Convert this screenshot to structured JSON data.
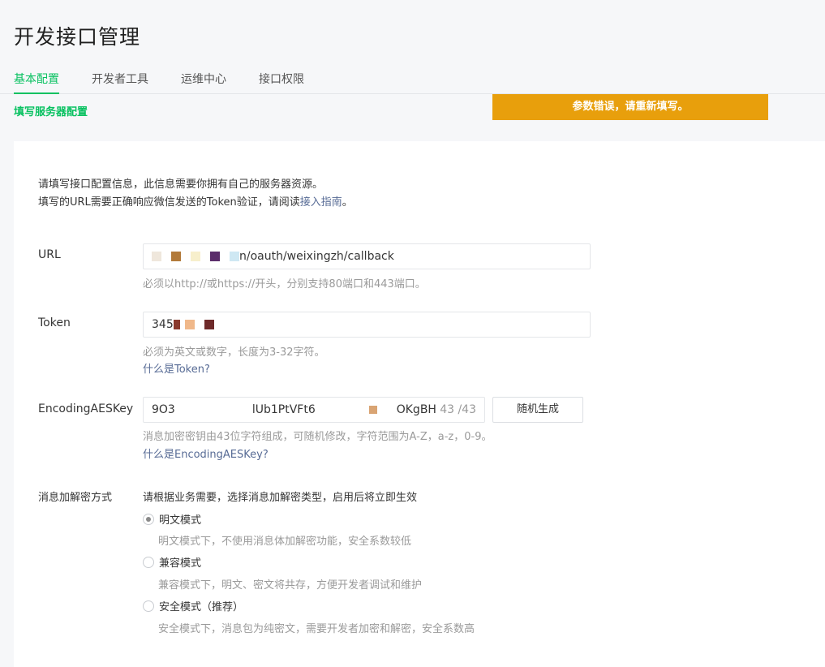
{
  "page": {
    "title": "开发接口管理"
  },
  "tabs": [
    {
      "label": "基本配置",
      "active": true
    },
    {
      "label": "开发者工具",
      "active": false
    },
    {
      "label": "运维中心",
      "active": false
    },
    {
      "label": "接口权限",
      "active": false
    }
  ],
  "subhead": "填写服务器配置",
  "toast": "参数错误，请重新填写。",
  "intro": {
    "line1": "请填写接口配置信息，此信息需要你拥有自己的服务器资源。",
    "line2_prefix": "填写的URL需要正确响应微信发送的Token验证，请阅读",
    "line2_link": "接入指南",
    "line2_suffix": "。"
  },
  "url": {
    "label": "URL",
    "value_suffix": "n/oauth/weixingzh/callback",
    "hint": "必须以http://或https://开头，分别支持80端口和443端口。"
  },
  "token": {
    "label": "Token",
    "value_prefix": "345",
    "hint": "必须为英文或数字，长度为3-32字符。",
    "help_link": "什么是Token?"
  },
  "aes": {
    "label": "EncodingAESKey",
    "value_a": "9O3",
    "value_b": "lUb1PtVFt6",
    "value_c": "OKgBH8",
    "counter": "43 /43",
    "generate_button": "随机生成",
    "hint": "消息加密密钥由43位字符组成，可随机修改，字符范围为A-Z，a-z，0-9。",
    "help_link": "什么是EncodingAESKey?"
  },
  "encryption": {
    "label": "消息加解密方式",
    "instruction": "请根据业务需要，选择消息加解密类型，启用后将立即生效",
    "options": [
      {
        "label": "明文模式",
        "desc": "明文模式下，不使用消息体加解密功能，安全系数较低",
        "selected": true
      },
      {
        "label": "兼容模式",
        "desc": "兼容模式下，明文、密文将共存，方便开发者调试和维护",
        "selected": false
      },
      {
        "label": "安全模式（推荐）",
        "desc": "安全模式下，消息包为纯密文，需要开发者加密和解密，安全系数高",
        "selected": false
      }
    ]
  },
  "colors": {
    "accent": "#07c160",
    "toast": "#e89f0c",
    "link": "#576b95"
  }
}
